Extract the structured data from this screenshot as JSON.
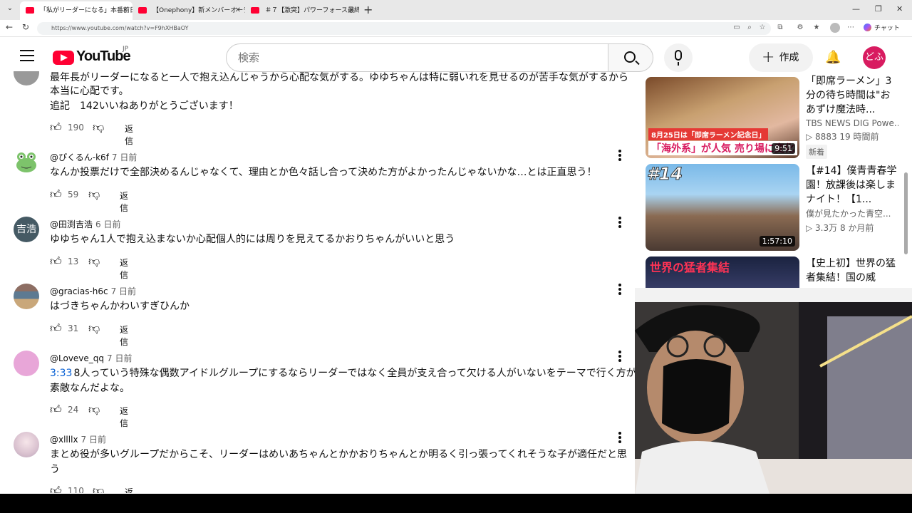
{
  "browser": {
    "tabs": [
      {
        "title": "「私がリーダーになる」本番前日の"
      },
      {
        "title": "【Onephony】新メンバーオーディション"
      },
      {
        "title": "＃７【激突】パワーフォース最終決戦！"
      }
    ],
    "url": "https://www.youtube.com/watch?v=F9hXHBaOY",
    "chat_label": "チャット"
  },
  "header": {
    "logo_word": "YouTube",
    "country": "JP",
    "search_placeholder": "検索",
    "create_label": "作成",
    "avatar_text": "どふ"
  },
  "comments": [
    {
      "text_lines": [
        "最年長がリーダーになると一人で抱え込んじゃうから心配な気がする。ゆゆちゃんは特に弱いれを見せるのが苦手な気がするから",
        "本当に心配です。",
        "追記　142いいねありがとうございます！"
      ],
      "likes": "190",
      "reply_label": "返信"
    },
    {
      "author": "@ぴくるん-k6f",
      "time": "7 日前",
      "text": "なんか投票だけで全部決めるんじゃなくて、理由とか色々話し合って決めた方がよかったんじゃないかな…とは正直思う！",
      "likes": "59",
      "reply_label": "返信"
    },
    {
      "author": "@田渕吉浩",
      "time": "6 日前",
      "avatar_text": "吉浩",
      "text": "ゆゆちゃん1人で抱え込まないか心配個人的には周りを見えてるかおりちゃんがいいと思う",
      "likes": "13",
      "reply_label": "返信"
    },
    {
      "author": "@gracias-h6c",
      "time": "7 日前",
      "text": "はづきちゃんかわいすぎひんか",
      "likes": "31",
      "reply_label": "返信"
    },
    {
      "author": "@Loveve_qq",
      "time": "7 日前",
      "timestamp_link": "3:33",
      "text_line1": "8人っていう特殊な偶数アイドルグループにするならリーダーではなく全員が支え合って欠ける人がいないをテーマで行く方が",
      "text_line2": "素敵なんだよな。",
      "likes": "24",
      "reply_label": "返信"
    },
    {
      "author": "@xllllx",
      "time": "7 日前",
      "text_line1": "まとめ役が多いグループだからこそ、リーダーはめいあちゃんとかかおりちゃんとか明るく引っ張ってくれそうな子が適任だと思",
      "text_line2": "う",
      "likes": "110",
      "reply_label": "返信"
    }
  ],
  "recommendations": [
    {
      "title": "「即席ラーメン」3分の待ち時間は\"おあずけ魔法時...",
      "channel": "TBS NEWS DIG Powe...",
      "views": "8883",
      "age": "19 時間前",
      "badge": "新着",
      "duration": "9:51",
      "thumb_caption_top": "8月25日は「即席ラーメン記念日」",
      "thumb_caption_bottom": "「海外系」が人気 売り場に変化"
    },
    {
      "title": "【#14】僕青青春学園！放課後は楽しまナイト！【1...",
      "channel": "僕が見たかった青空...",
      "views": "3.3万",
      "age": "8 か月前",
      "duration": "1:57:10",
      "thumb_caption_top": "#14"
    },
    {
      "title": "【史上初】世界の猛者集結！国の威",
      "thumb_caption_top": "世界の猛者集結"
    }
  ]
}
